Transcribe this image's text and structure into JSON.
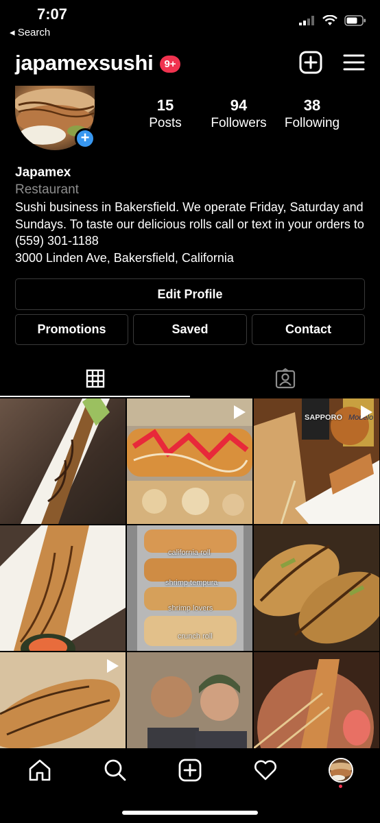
{
  "status_bar": {
    "time": "7:07",
    "back_label": "Search"
  },
  "header": {
    "username": "japamexsushi",
    "notification_badge": "9+"
  },
  "stats": [
    {
      "value": "15",
      "label": "Posts"
    },
    {
      "value": "94",
      "label": "Followers"
    },
    {
      "value": "38",
      "label": "Following"
    }
  ],
  "bio": {
    "name": "Japamex",
    "category": "Restaurant",
    "description": "Sushi business in Bakersfield. We operate Friday, Saturday and Sundays. To taste our delicious rolls call or text in your orders to (559) 301-1188",
    "address": "3000 Linden Ave, Bakersfield, California"
  },
  "buttons": {
    "edit_profile": "Edit Profile",
    "promotions": "Promotions",
    "saved": "Saved",
    "contact": "Contact"
  },
  "tabs": [
    {
      "icon": "grid-icon",
      "active": true
    },
    {
      "icon": "tagged-icon",
      "active": false
    }
  ],
  "grid_labels": {
    "post2_bottles_left": "SAPPORO",
    "post2_bottles_right": "Modelo",
    "post4_rolls": [
      "california roll",
      "shrimp tempura",
      "shrimp lovers",
      "crunch roll"
    ]
  },
  "bottom_nav": [
    "home-icon",
    "search-icon",
    "new-post-icon",
    "activity-heart-icon",
    "profile-avatar"
  ],
  "colors": {
    "accent_blue": "#3897f0",
    "badge_red": "#f0334f",
    "muted_text": "#8e8e8e",
    "border": "#3a3a3a"
  }
}
